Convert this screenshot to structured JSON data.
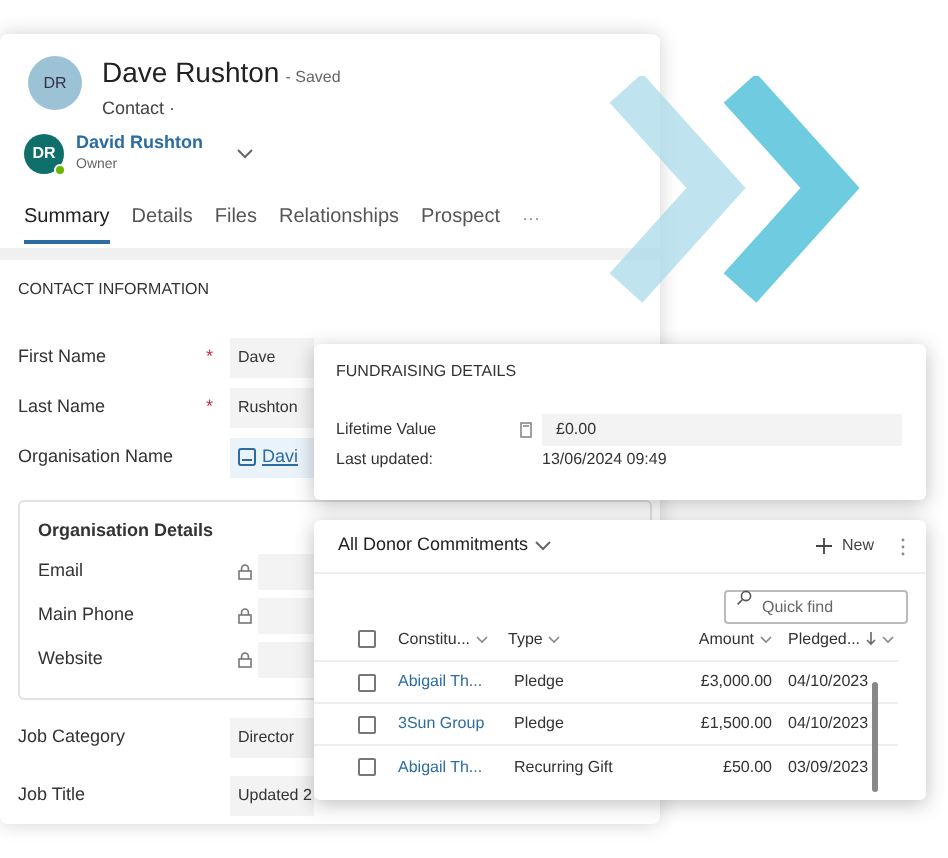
{
  "contact": {
    "avatar": "DR",
    "name": "Dave Rushton",
    "status": "- Saved",
    "type": "Contact ·",
    "owner": {
      "avatar": "DR",
      "name": "David Rushton",
      "role": "Owner",
      "online": true
    }
  },
  "tabs": [
    {
      "label": "Summary",
      "selected": true
    },
    {
      "label": "Details",
      "selected": false
    },
    {
      "label": "Files",
      "selected": false
    },
    {
      "label": "Relationships",
      "selected": false
    },
    {
      "label": "Prospect",
      "selected": false
    }
  ],
  "more": "···",
  "section": "CONTACT INFORMATION",
  "fields": [
    {
      "label": "First Name",
      "required_mark": "*",
      "kind": "text",
      "value": "Dave"
    },
    {
      "label": "Last Name",
      "required_mark": "*",
      "kind": "text",
      "value": "Rushton"
    },
    {
      "label": "Organisation Name",
      "kind": "lookup",
      "value": "Davi"
    }
  ],
  "org_details": {
    "title": "Organisation Details",
    "fields": [
      {
        "label": "Email",
        "locked": true
      },
      {
        "label": "Main Phone",
        "locked": true
      },
      {
        "label": "Website",
        "locked": true
      }
    ]
  },
  "job_fields": [
    {
      "label": "Job Category",
      "kind": "text",
      "value": "Director"
    },
    {
      "label": "Job Title",
      "kind": "text",
      "value": "Updated 2"
    }
  ],
  "fundraising": {
    "title": "FUNDRAISING DETAILS",
    "lifetime_label": "Lifetime Value",
    "lifetime_value": "£0.00",
    "updated_label": "Last updated:",
    "updated_value": "13/06/2024 09:49"
  },
  "donor": {
    "title": "All Donor Commitments",
    "new_label": "New",
    "search": {
      "placeholder": "Quick find"
    },
    "all_selected": false,
    "columns": [
      {
        "label": "Constitu...",
        "sorted": false
      },
      {
        "label": "Type",
        "sorted": false
      },
      {
        "label": "Amount",
        "sorted": false
      },
      {
        "label": "Pledged...",
        "sorted": true
      }
    ],
    "rows": [
      {
        "checked": false,
        "constituent": "Abigail Th...",
        "type": "Pledge",
        "amount": "£3,000.00",
        "pledged": "04/10/2023"
      },
      {
        "checked": false,
        "constituent": "3Sun Group",
        "type": "Pledge",
        "amount": "£1,500.00",
        "pledged": "04/10/2023"
      },
      {
        "checked": false,
        "constituent": "Abigail Th...",
        "type": "Recurring Gift",
        "amount": "£50.00",
        "pledged": "03/09/2023"
      }
    ]
  }
}
